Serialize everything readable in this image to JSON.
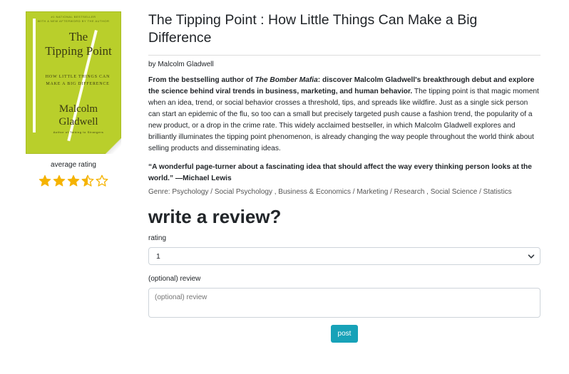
{
  "book": {
    "cover": {
      "tiny_line_1": "#1 National Bestseller",
      "tiny_line_2": "With a new afterword by the author",
      "title_line_1": "The",
      "title_line_2": "Tipping Point",
      "subtitle_line_1": "HOW LITTLE THINGS CAN",
      "subtitle_line_2": "MAKE A BIG DIFFERENCE",
      "author_line_1": "Malcolm",
      "author_line_2": "Gladwell",
      "foot": "Author of Talking to Strangers",
      "color": "#b9cf2b"
    },
    "average_rating_label": "average rating",
    "rating_stars": {
      "filled": 3,
      "half": 1,
      "empty": 1,
      "value": 3.5
    },
    "star_color": "#f5b301",
    "title": "The Tipping Point : How Little Things Can Make a Big Difference",
    "author_line": "by Malcolm Gladwell",
    "description": {
      "bold_intro_1": "From the bestselling author of ",
      "bold_italic": "The Bomber Mafia",
      "bold_intro_2": ": discover Malcolm Gladwell's breakthrough debut and explore the science behind viral trends in business, marketing, and human behavior.",
      "body": " The tipping point is that magic moment when an idea, trend, or social behavior crosses a threshold, tips, and spreads like wildfire. Just as a single sick person can start an epidemic of the flu, so too can a small but precisely targeted push cause a fashion trend, the popularity of a new product, or a drop in the crime rate. This widely acclaimed bestseller, in which Malcolm Gladwell explores and brilliantly illuminates the tipping point phenomenon, is already changing the way people throughout the world think about selling products and disseminating ideas."
    },
    "quote": "“A wonderful page-turner about a fascinating idea that should affect the way every thinking person looks at the world.” —Michael Lewis",
    "genre": "Genre: Psychology / Social Psychology , Business & Economics / Marketing / Research , Social Science / Statistics"
  },
  "review_form": {
    "heading": "write a review?",
    "rating_label": "rating",
    "rating_value": "1",
    "review_label": "(optional) review",
    "review_placeholder": "(optional) review",
    "post_label": "post",
    "accent": "#17a2b8"
  }
}
